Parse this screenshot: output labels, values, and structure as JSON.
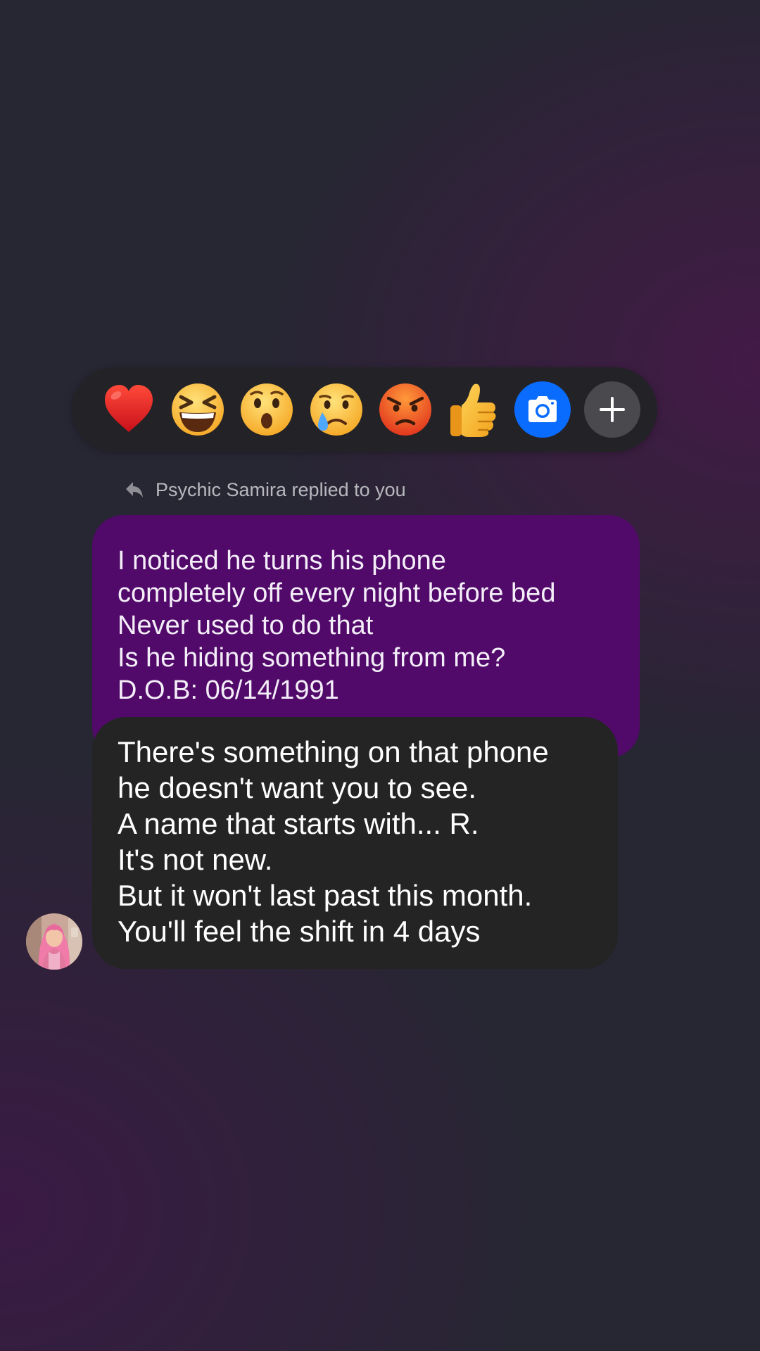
{
  "reactions": [
    {
      "icon": "red-heart-icon",
      "glyph": "heart"
    },
    {
      "icon": "laughing-face-icon",
      "glyph": "laugh"
    },
    {
      "icon": "hushed-face-icon",
      "glyph": "wow"
    },
    {
      "icon": "crying-face-icon",
      "glyph": "sad"
    },
    {
      "icon": "angry-face-icon",
      "glyph": "angry"
    },
    {
      "icon": "thumbs-up-icon",
      "glyph": "like"
    }
  ],
  "actions": {
    "camera_icon": "camera-icon",
    "camera_color": "#0a6cff",
    "add_icon": "plus-icon",
    "add_color": "#4a4a4e"
  },
  "reply_header": {
    "icon": "reply-arrow-icon",
    "text": "Psychic Samira replied to you"
  },
  "quoted_message": {
    "bubble_color": "#520a6a",
    "lines": [
      "I noticed he turns his phone",
      "completely off every night before bed",
      "Never used to do that",
      "Is he hiding something from me?",
      "D.O.B: 06/14/1991"
    ]
  },
  "reply_message": {
    "bubble_color": "#242424",
    "lines": [
      "There's something on that phone",
      "he doesn't want you to see.",
      "A name that starts with... R.",
      "It's not new.",
      "But it won't last past this month.",
      "You'll feel the shift in 4 days"
    ]
  },
  "avatar": {
    "icon": "sender-avatar",
    "hair_color": "#f07aa8"
  }
}
